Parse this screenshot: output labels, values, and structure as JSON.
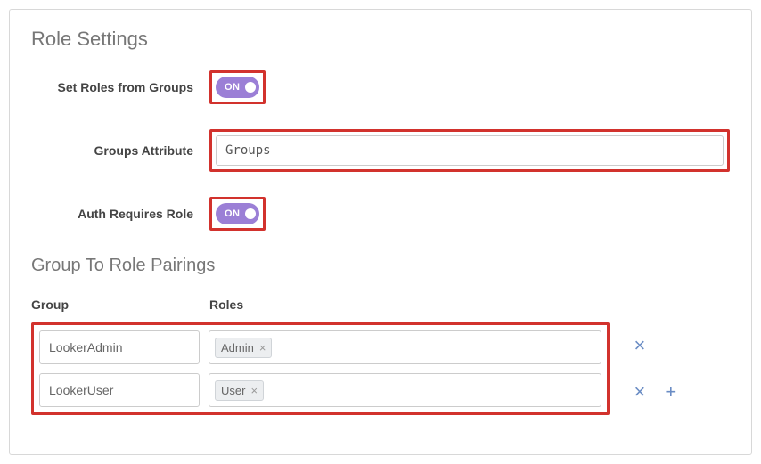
{
  "sectionTitle": "Role Settings",
  "fields": {
    "setRolesFromGroups": {
      "label": "Set Roles from Groups",
      "toggleText": "ON"
    },
    "groupsAttribute": {
      "label": "Groups Attribute",
      "value": "Groups"
    },
    "authRequiresRole": {
      "label": "Auth Requires Role",
      "toggleText": "ON"
    }
  },
  "pairingsSection": {
    "title": "Group To Role Pairings",
    "headers": {
      "group": "Group",
      "roles": "Roles"
    },
    "rows": [
      {
        "group": "LookerAdmin",
        "role": "Admin"
      },
      {
        "group": "LookerUser",
        "role": "User"
      }
    ]
  }
}
